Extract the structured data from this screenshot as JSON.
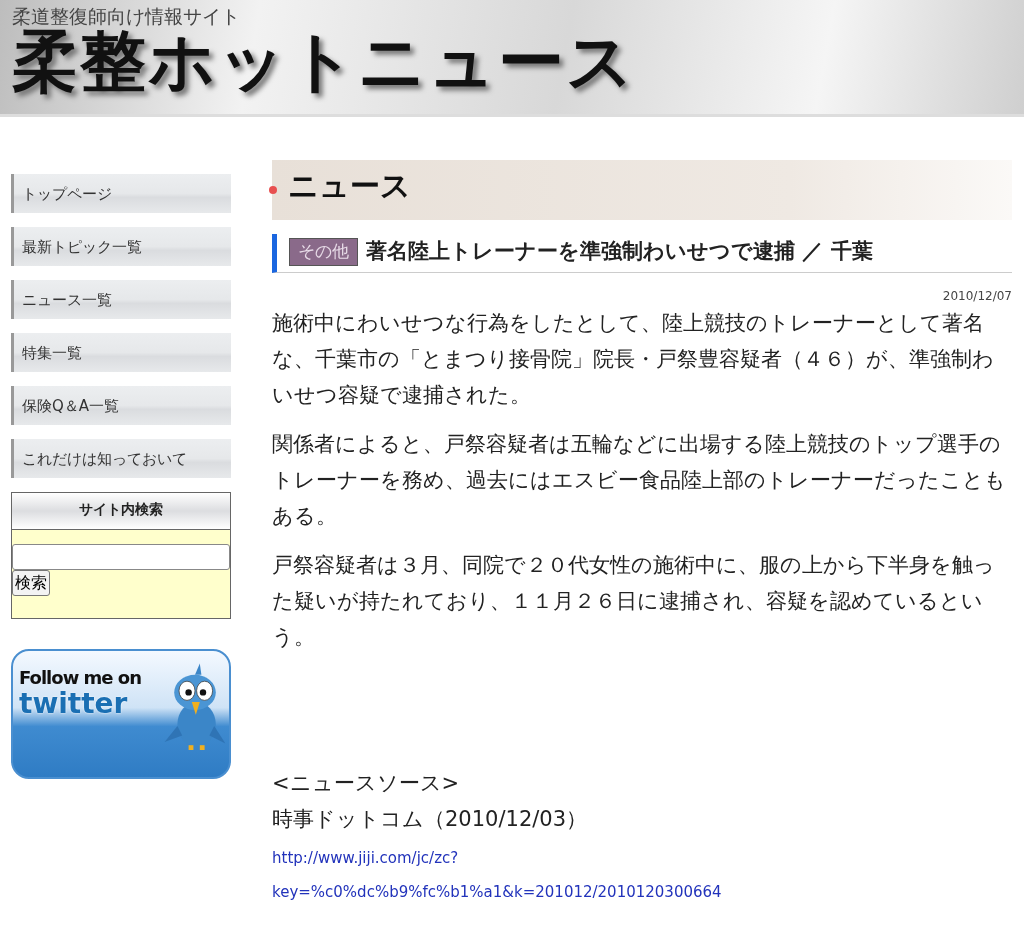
{
  "header": {
    "tagline": "柔道整復師向け情報サイト",
    "site_title": "柔整ホットニュース"
  },
  "sidebar": {
    "menu": [
      {
        "label": "トップページ"
      },
      {
        "label": "最新トピック一覧"
      },
      {
        "label": "ニュース一覧"
      },
      {
        "label": "特集一覧"
      },
      {
        "label": "保険Q＆A一覧"
      },
      {
        "label": "これだけは知っておいて"
      }
    ],
    "search": {
      "title": "サイト内検索",
      "button": "検索"
    },
    "banner": {
      "line1": "Follow me on",
      "line2": "twitter"
    }
  },
  "main": {
    "section_title": "ニュース",
    "article": {
      "category": "その他",
      "title": "著名陸上トレーナーを準強制わいせつで逮捕 ／ 千葉",
      "date": "2010/12/07",
      "paragraphs": [
        "施術中にわいせつな行為をしたとして、陸上競技のトレーナーとして著名な、千葉市の「とまつり接骨院」院長・戸祭豊容疑者（４６）が、準強制わいせつ容疑で逮捕された。",
        "関係者によると、戸祭容疑者は五輪などに出場する陸上競技のトップ選手のトレーナーを務め、過去にはエスビー食品陸上部のトレーナーだったこともある。",
        "戸祭容疑者は３月、同院で２０代女性の施術中に、服の上から下半身を触った疑いが持たれており、１１月２６日に逮捕され、容疑を認めているという。"
      ],
      "source_heading": "<ニュースソース>",
      "source": "時事ドットコム（2010/12/03）",
      "source_link_lines": [
        "http://www.jiji.com/jc/zc?",
        "key=%c0%dc%b9%fc%b1%a1&k=201012/2010120300664"
      ]
    }
  }
}
